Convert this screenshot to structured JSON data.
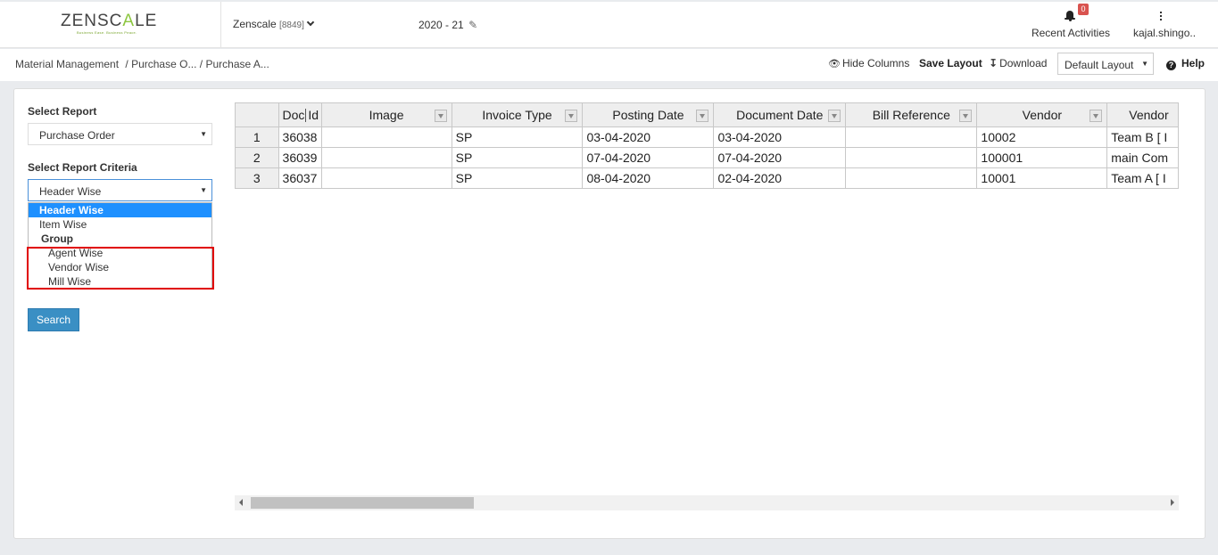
{
  "header": {
    "logo_prefix": "ZENSC",
    "logo_accent": "A",
    "logo_suffix": "LE",
    "tagline": "Business Ease. Business Peace.",
    "company_name": "Zenscale",
    "company_code": "[8849]",
    "fiscal_year": "2020 - 21",
    "notification_count": "0",
    "recent_activities": "Recent Activities",
    "user_name": "kajal.shingo.."
  },
  "breadcrumb": {
    "root": "Material Management",
    "level1": "/ Purchase O...",
    "level2": "/ Purchase A..."
  },
  "toolbar": {
    "hide_columns": "Hide Columns",
    "save_layout": "Save Layout",
    "download": "Download",
    "layout_value": "Default Layout",
    "help": "Help"
  },
  "filters": {
    "report_label": "Select Report",
    "report_value": "Purchase Order",
    "criteria_label": "Select Report Criteria",
    "criteria_value": "Header Wise",
    "options": [
      {
        "label": "Header Wise",
        "kind": "selected"
      },
      {
        "label": "Item Wise",
        "kind": "normal"
      },
      {
        "label": "Group",
        "kind": "group"
      },
      {
        "label": "Agent Wise",
        "kind": "child"
      },
      {
        "label": "Vendor Wise",
        "kind": "child"
      },
      {
        "label": "Mill Wise",
        "kind": "child"
      }
    ],
    "search_label": "Search"
  },
  "table": {
    "columns": [
      "",
      "Doc Id",
      "Image",
      "Invoice Type",
      "Posting Date",
      "Document Date",
      "Bill Reference",
      "Vendor",
      "Vendor"
    ],
    "rows": [
      [
        "1",
        "36038",
        "",
        "SP",
        "03-04-2020",
        "03-04-2020",
        "",
        "10002",
        "Team B [ I"
      ],
      [
        "2",
        "36039",
        "",
        "SP",
        "07-04-2020",
        "07-04-2020",
        "",
        "100001",
        "main Com"
      ],
      [
        "3",
        "36037",
        "",
        "SP",
        "08-04-2020",
        "02-04-2020",
        "",
        "10001",
        "Team A [ I"
      ]
    ]
  },
  "colors": {
    "accent": "#8cc63f",
    "selection": "#1e90ff",
    "button": "#3a8fc4",
    "highlight_box": "#e00000",
    "badge": "#d9534f"
  }
}
